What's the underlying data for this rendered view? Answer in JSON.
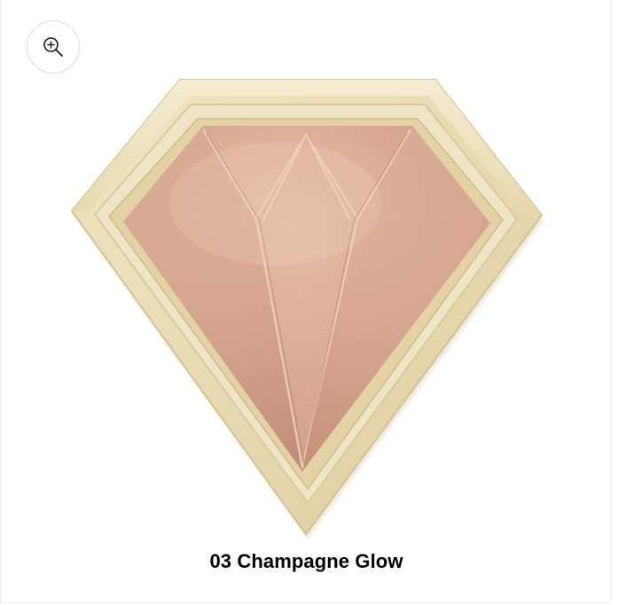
{
  "product": {
    "caption": "03 Champagne Glow",
    "image_subject": "diamond-shaped highlighter compact"
  },
  "zoom": {
    "icon": "zoom-in-icon"
  },
  "colors": {
    "case_outer": "#e9dcb6",
    "case_inner": "#f3ead0",
    "case_edge": "#d9c99c",
    "powder_base": "#d19b84",
    "powder_light": "#e8c1ad",
    "powder_dark": "#b27a66",
    "caption_text": "#000000"
  }
}
